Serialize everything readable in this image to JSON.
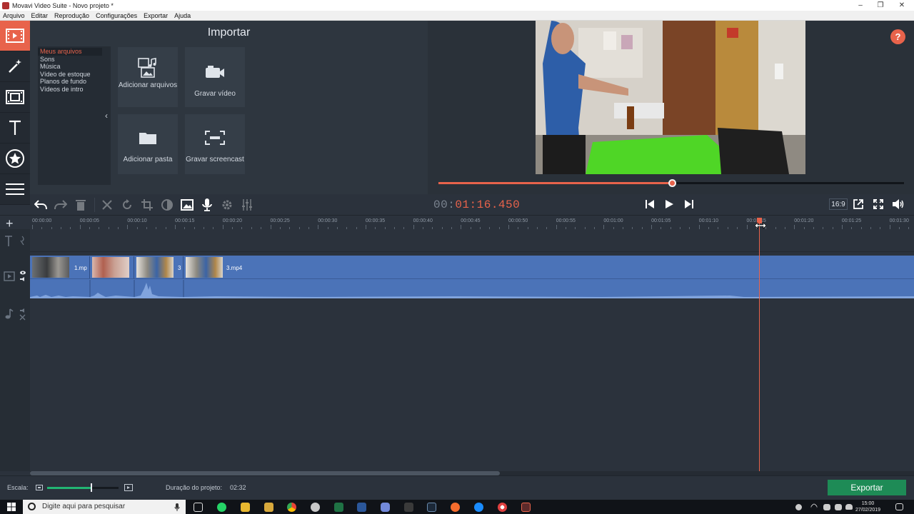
{
  "window": {
    "title": "Movavi Video Suite - Novo projeto *",
    "controls": [
      "minimize-icon",
      "maximize-icon",
      "close-icon"
    ]
  },
  "menu": [
    "Arquivo",
    "Editar",
    "Reprodução",
    "Configurações",
    "Exportar",
    "Ajuda"
  ],
  "sidebar_tools": [
    {
      "name": "import-tool",
      "icon": "film-import-icon",
      "active": true
    },
    {
      "name": "filters-tool",
      "icon": "magic-wand-icon",
      "active": false
    },
    {
      "name": "transitions-tool",
      "icon": "transition-icon",
      "active": false
    },
    {
      "name": "titles-tool",
      "icon": "text-icon",
      "active": false
    },
    {
      "name": "stickers-tool",
      "icon": "star-icon",
      "active": false
    },
    {
      "name": "more-tools",
      "icon": "list-icon",
      "active": false
    }
  ],
  "import": {
    "title": "Importar",
    "categories": [
      "Meus arquivos",
      "Sons",
      "Música",
      "Vídeo de estoque",
      "Planos de fundo",
      "Vídeos de intro"
    ],
    "selected_category": "Meus arquivos",
    "cards": {
      "add_files": "Adicionar arquivos",
      "record_video": "Gravar vídeo",
      "add_folder": "Adicionar pasta",
      "screencast": "Gravar screencast"
    }
  },
  "preview": {
    "help_label": "?",
    "timecode_prefix": "00:",
    "timecode_value": "01:16.450",
    "playback_progress": 0.5,
    "aspect_ratio": "16:9"
  },
  "timeline": {
    "ruler_labels": [
      "00:00:00",
      "00:00:05",
      "00:00:10",
      "00:00:15",
      "00:00:20",
      "00:00:25",
      "00:00:30",
      "00:00:35",
      "00:00:40",
      "00:00:45",
      "00:00:50",
      "00:00:55",
      "00:01:00",
      "00:01:05",
      "00:01:10",
      "00:01:15",
      "00:01:20",
      "00:01:25",
      "00:01:30"
    ],
    "clips": [
      "1.mp",
      "",
      "3",
      "3.mp4"
    ]
  },
  "status": {
    "scale_label": "Escala:",
    "zoom_level": 0.62,
    "duration_label": "Duração do projeto:",
    "duration_value": "02:32",
    "export_label": "Exportar"
  },
  "taskbar": {
    "search_placeholder": "Digite aqui para pesquisar",
    "time": "15:00",
    "date": "27/02/2019"
  },
  "colors": {
    "accent": "#e8634b",
    "track": "#4b73b8",
    "export": "#1e8b56"
  }
}
